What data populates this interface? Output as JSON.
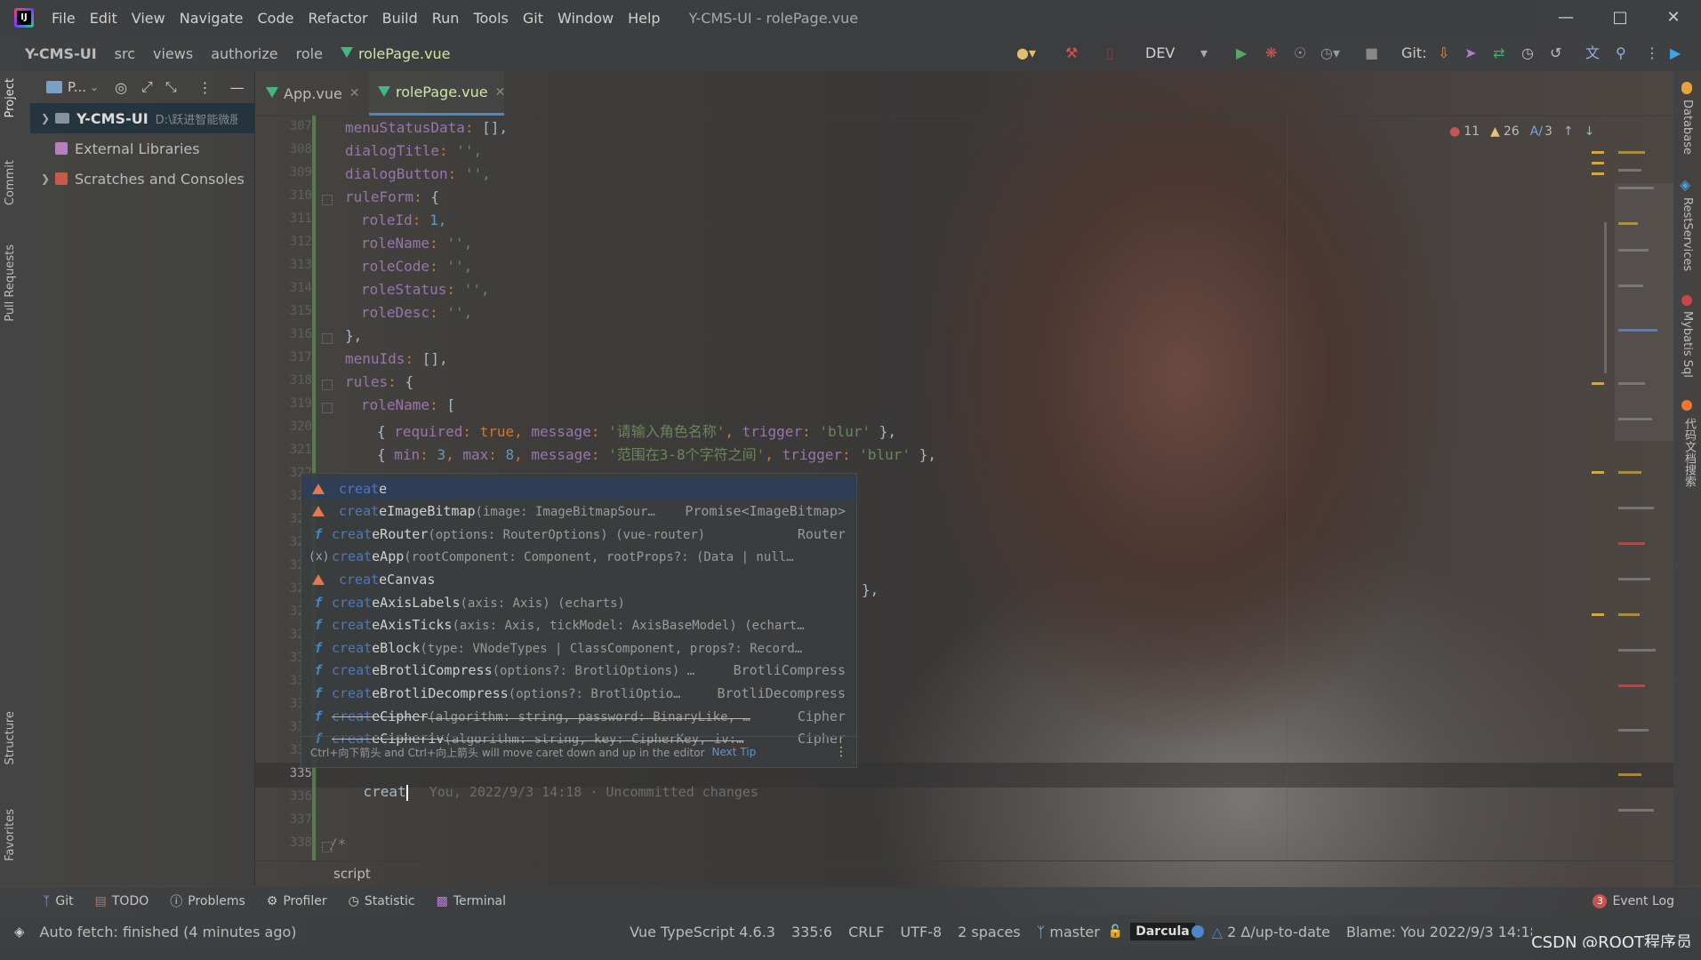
{
  "window": {
    "title": "Y-CMS-UI - rolePage.vue",
    "menu": [
      "File",
      "Edit",
      "View",
      "Navigate",
      "Code",
      "Refactor",
      "Build",
      "Run",
      "Tools",
      "Git",
      "Window",
      "Help"
    ]
  },
  "navbar": {
    "breadcrumbs": [
      "Y-CMS-UI",
      "src",
      "views",
      "authorize",
      "role",
      "rolePage.vue"
    ],
    "run_config": "DEV",
    "git_label": "Git:"
  },
  "left_tool_windows": [
    "Project",
    "Commit",
    "Pull Requests",
    "Structure",
    "Favorites"
  ],
  "project_panel": {
    "view_label": "P...",
    "tree": [
      {
        "label": "Y-CMS-UI",
        "hint": "D:\\跃进智能微服",
        "expanded": false
      },
      {
        "label": "External Libraries"
      },
      {
        "label": "Scratches and Consoles"
      }
    ]
  },
  "tabs": [
    {
      "label": "App.vue",
      "active": false
    },
    {
      "label": "rolePage.vue",
      "active": true
    }
  ],
  "inspections": {
    "errors": "11",
    "warnings": "26",
    "typos": "3"
  },
  "editor": {
    "line_numbers": [
      "307",
      "308",
      "309",
      "310",
      "311",
      "312",
      "313",
      "314",
      "315",
      "316",
      "317",
      "318",
      "319",
      "320",
      "321",
      "322",
      "323",
      "324",
      "325",
      "326",
      "327",
      "328",
      "329",
      "330",
      "331",
      "332",
      "333",
      "334",
      "335",
      "336",
      "337",
      "338"
    ],
    "current_line_number": "335",
    "typed_text": "creat",
    "blame_hint": "You, 2022/9/3 14:18 · Uncommitted changes",
    "trailing_fragment": "},",
    "comment_start": "/*",
    "code": {
      "l307_key": "menuStatusData",
      "l307_val": "[],",
      "l308_key": "dialogTitle",
      "l308_val": "'',",
      "l309_key": "dialogButton",
      "l309_val": "'',",
      "l310_key": "ruleForm",
      "l310_val": "{",
      "l311_key": "roleId",
      "l311_val": "1,",
      "l312_key": "roleName",
      "l312_val": "'',",
      "l313_key": "roleCode",
      "l313_val": "'',",
      "l314_key": "roleStatus",
      "l314_val": "'',",
      "l315_key": "roleDesc",
      "l315_val": "'',",
      "l316": "},",
      "l317_key": "menuIds",
      "l317_val": "[],",
      "l318_key": "rules",
      "l318_val": "{",
      "l319_key": "roleName",
      "l319_val": "[",
      "l320_a": "{ ",
      "l320_req": "required",
      "l320_true": "true",
      "l320_msg": "message",
      "l320_msgval": "'请输入角色名称'",
      "l320_trig": "trigger",
      "l320_trigval": "'blur'",
      "l320_end": " },",
      "l321_a": "{ ",
      "l321_min": "min",
      "l321_minv": "3",
      "l321_max": "max",
      "l321_maxv": "8",
      "l321_msg": "message",
      "l321_msgval": "'范围在3-8个字符之间'",
      "l321_trig": "trigger",
      "l321_trigval": "'blur'",
      "l321_end": " },"
    }
  },
  "completion": {
    "match": "creat",
    "items": [
      {
        "icon": "class",
        "rest": "e",
        "sig": "",
        "type": ""
      },
      {
        "icon": "class",
        "rest": "eImageBitmap",
        "sig": "(image: ImageBitmapSour…",
        "type": "Promise<ImageBitmap>"
      },
      {
        "icon": "function",
        "rest": "eRouter",
        "sig": "(options: RouterOptions) (vue-router)",
        "type": "Router"
      },
      {
        "icon": "variable",
        "rest": "eApp",
        "sig": "(rootComponent: Component, rootProps?: (Data | null…",
        "type": ""
      },
      {
        "icon": "class",
        "rest": "eCanvas",
        "sig": "",
        "type": ""
      },
      {
        "icon": "function",
        "rest": "eAxisLabels",
        "sig": "(axis: Axis) (echarts)",
        "type": ""
      },
      {
        "icon": "function",
        "rest": "eAxisTicks",
        "sig": "(axis: Axis, tickModel: AxisBaseModel) (echart…",
        "type": ""
      },
      {
        "icon": "function",
        "rest": "eBlock",
        "sig": "(type: VNodeTypes | ClassComponent, props?: Record…",
        "type": ""
      },
      {
        "icon": "function",
        "rest": "eBrotliCompress",
        "sig": "(options?: BrotliOptions) …",
        "type": "BrotliCompress"
      },
      {
        "icon": "function",
        "rest": "eBrotliDecompress",
        "sig": "(options?: BrotliOptio…",
        "type": "BrotliDecompress"
      },
      {
        "icon": "function",
        "rest": "eCipher",
        "sig": "(algorithm: string, password: BinaryLike, …",
        "type": "Cipher",
        "deprecated": true
      },
      {
        "icon": "function",
        "rest": "eCipheriv",
        "sig": "(algorithm: string, key: CipherKey, iv:…",
        "type": "Cipher",
        "deprecated": true
      }
    ],
    "footer_tip": "Ctrl+向下箭头 and Ctrl+向上箭头 will move caret down and up in the editor",
    "next_tip": "Next Tip"
  },
  "editor_breadcrumb": "script",
  "right_tool_windows": [
    "Database",
    "RestServices",
    "Mybatis Sql",
    "代码文档搜索"
  ],
  "bottom_tools": [
    "Git",
    "TODO",
    "Problems",
    "Profiler",
    "Statistic",
    "Terminal"
  ],
  "event_log": {
    "count": "3",
    "label": "Event Log"
  },
  "status": {
    "message": "Auto fetch: finished (4 minutes ago)",
    "language": "Vue TypeScript 4.6.3",
    "position": "335:6",
    "line_sep": "CRLF",
    "encoding": "UTF-8",
    "indent": "2 spaces",
    "branch": "master",
    "theme": "Darcula",
    "git_state": "2 Δ/up-to-date",
    "blame": "Blame: You 2022/9/3 14:18"
  },
  "watermark": "CSDN @ROOT程序员",
  "colors": {
    "accent": "#4a88c7",
    "vue": "#41b883",
    "error": "#c75450",
    "warning": "#e5c07b"
  }
}
